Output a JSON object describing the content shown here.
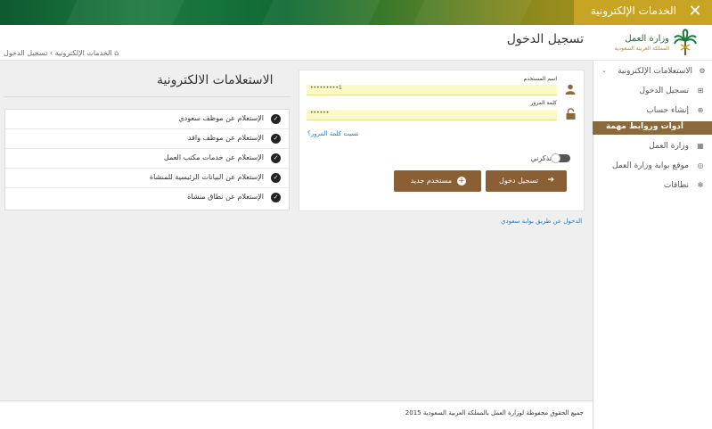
{
  "topbar": {
    "title": "الخدمات الإلكترونية",
    "close_icon": "close-icon"
  },
  "header": {
    "page_title": "تسجيل الدخول"
  },
  "breadcrumb": {
    "home_icon": "home-icon",
    "home": "الخدمات الإلكترونية",
    "separator": "›",
    "current": "تسجيل الدخول"
  },
  "logo": {
    "name": "وزارة العمل",
    "subtitle": "المملكة العربية السعودية"
  },
  "sidebar": {
    "items": [
      {
        "label": "الاستعلامات الإلكترونية",
        "icon": "cogs-icon",
        "chevron": "⌄"
      },
      {
        "label": "تسجيل الدخول",
        "icon": "login-icon"
      },
      {
        "label": "إنشاء حساب",
        "icon": "plus-circle-icon"
      },
      {
        "label": "أدوات وروابط مهمة",
        "active": true
      },
      {
        "label": "وزارة العمل",
        "icon": "building-icon"
      },
      {
        "label": "موقع بوابة وزارة العمل",
        "icon": "globe-icon"
      },
      {
        "label": "نطاقات",
        "icon": "gear-icon"
      }
    ]
  },
  "login": {
    "username_label": "اسم المستخدم",
    "username_value": "1•••••••••",
    "password_label": "كلمة المرور",
    "password_value": "••••••",
    "forgot": "نسيت كلمة المرور؟",
    "remember": "تذكرني",
    "login_button": "تسجيل دخول",
    "new_user_button": "مستخدم جديد",
    "saudi_link": "الدخول عن طريق بوابة سعودي"
  },
  "inquiries": {
    "title": "الاستعلامات الالكترونية",
    "items": [
      "الإستعلام عن موظف سعودي",
      "الإستعلام عن موظف وافد",
      "الإستعلام عن خدمات مكتب العمل",
      "الإستعلام عن البيانات الرئيسية للمنشاة",
      "الإستعلام عن نطاق منشاة"
    ]
  },
  "footer": {
    "copyright": "جميع الحقوق محفوظة لوزارة العمل بالمملكة العربية السعودية 2015"
  },
  "colors": {
    "brand_green": "#1a6a37",
    "gold": "#c8a424",
    "button_brown": "#8a5f34",
    "input_yellow": "#fafac4",
    "link_blue": "#2a7ac4"
  }
}
